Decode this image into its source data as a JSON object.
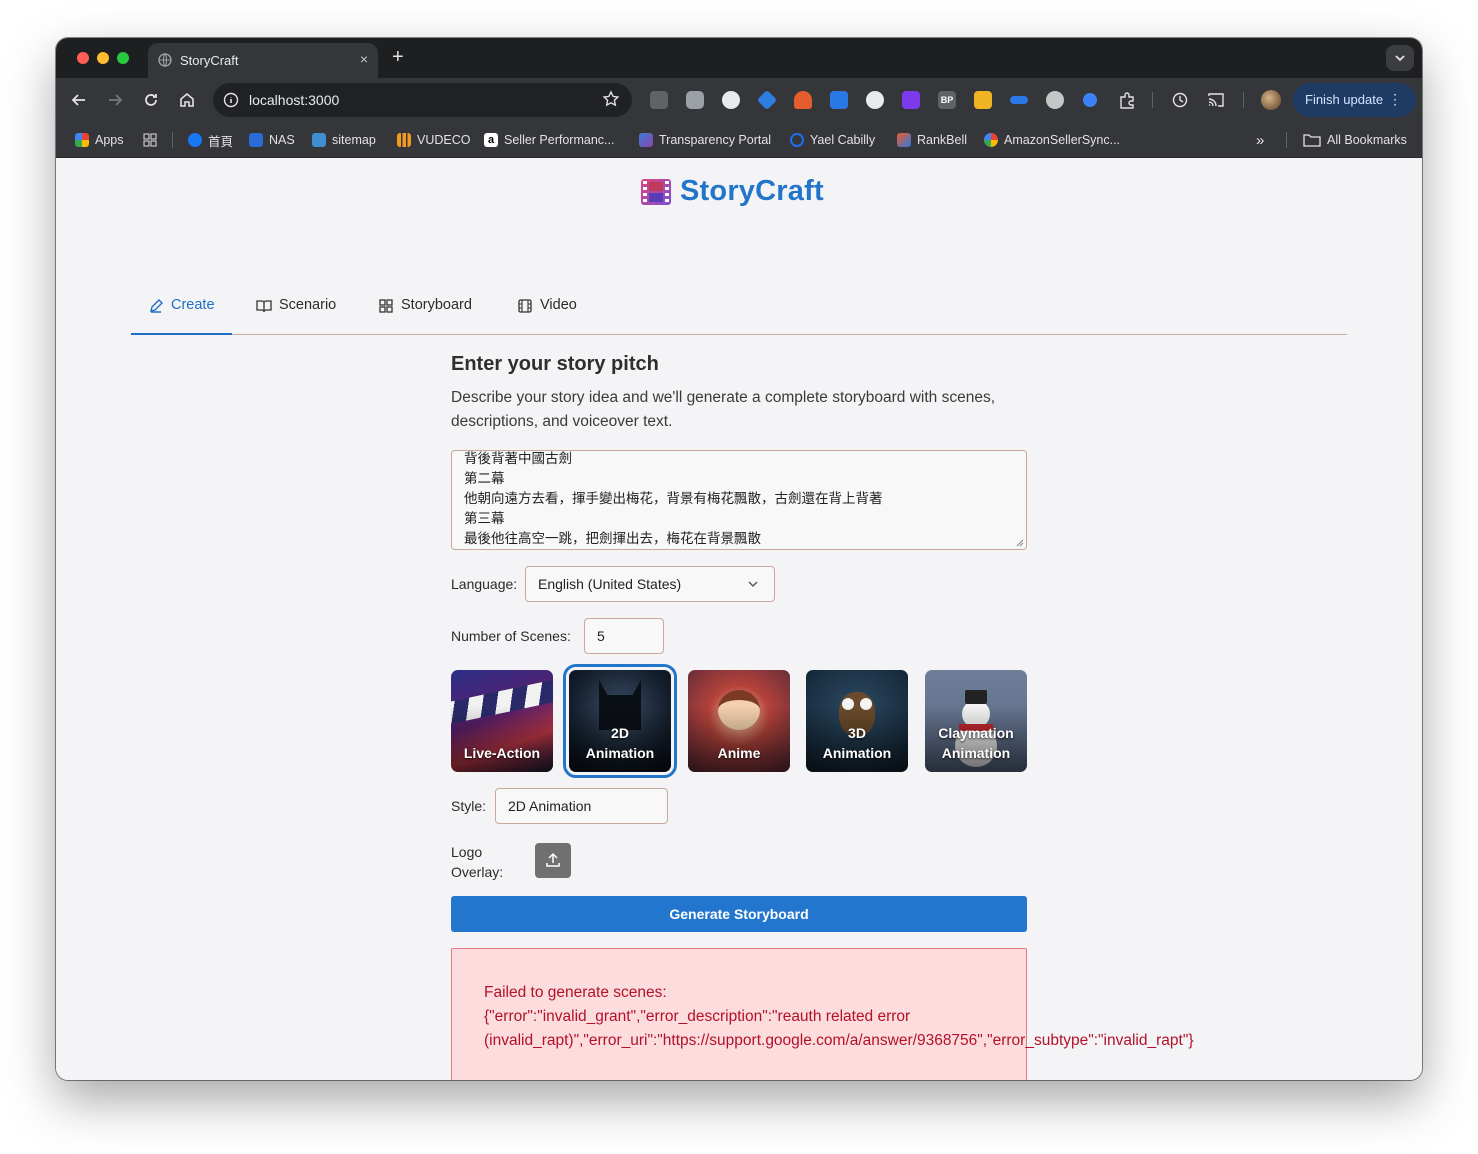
{
  "browser": {
    "tab_title": "StoryCraft",
    "tab_close": "×",
    "new_tab": "+",
    "url": "localhost:3000",
    "finish_update": "Finish update",
    "bookmarks": [
      {
        "label": "Apps",
        "icon": "apps-grid-icon",
        "color": "#e8453c"
      },
      {
        "label": "",
        "icon": "grid-icon",
        "color": "#e3e3e3"
      },
      {
        "label": "首頁",
        "icon": "facebook-icon",
        "color": "#1877f2"
      },
      {
        "label": "NAS",
        "icon": "dsm-icon",
        "color": "#2a6bd6"
      },
      {
        "label": "sitemap",
        "icon": "sitemap-icon",
        "color": "#3e8ed0"
      },
      {
        "label": "VUDECO",
        "icon": "analytics-icon",
        "color": "#f29a1d"
      },
      {
        "label": "Seller Performanc...",
        "icon": "amazon-icon",
        "color": "#ffffff"
      },
      {
        "label": "Transparency Portal",
        "icon": "transparency-icon",
        "color": "#3a7bd5"
      },
      {
        "label": "Yael Cabilly",
        "icon": "ring-icon",
        "color": "#1d6ef0"
      },
      {
        "label": "RankBell",
        "icon": "rankbell-icon",
        "color": "#f05a28"
      },
      {
        "label": "AmazonSellerSync...",
        "icon": "google-icon",
        "color": "#ffffff"
      }
    ],
    "overflow": "»",
    "all_bookmarks": "All Bookmarks"
  },
  "app": {
    "brand": "StoryCraft",
    "tabs": [
      {
        "label": "Create",
        "icon": "pencil-icon",
        "active": true
      },
      {
        "label": "Scenario",
        "icon": "book-icon",
        "active": false
      },
      {
        "label": "Storyboard",
        "icon": "grid-icon",
        "active": false
      },
      {
        "label": "Video",
        "icon": "film-icon",
        "active": false
      }
    ],
    "heading": "Enter your story pitch",
    "description": "Describe your story idea and we'll generate a complete storyboard with scenes, descriptions, and voiceover text.",
    "pitch_lines": [
      "背後背著中國古劍",
      "第二幕",
      "他朝向遠方去看，揮手變出梅花，背景有梅花飄散，古劍還在背上背著",
      "第三幕",
      "最後他往高空一跳，把劍揮出去，梅花在背景飄散"
    ],
    "language_label": "Language:",
    "language_value": "English (United States)",
    "scenes_label": "Number of Scenes:",
    "scenes_value": "5",
    "styles": [
      {
        "line1": "",
        "line2": "Live-Action",
        "selected": false
      },
      {
        "line1": "2D",
        "line2": "Animation",
        "selected": true
      },
      {
        "line1": "",
        "line2": "Anime",
        "selected": false
      },
      {
        "line1": "3D",
        "line2": "Animation",
        "selected": false
      },
      {
        "line1": "Claymation",
        "line2": "Animation",
        "selected": false
      }
    ],
    "style_label": "Style:",
    "style_value": "2D Animation",
    "logo_label_1": "Logo",
    "logo_label_2": "Overlay:",
    "generate_label": "Generate Storyboard",
    "error_lines": [
      "Failed to generate scenes:",
      "{\"error\":\"invalid_grant\",\"error_description\":\"reauth related error",
      "(invalid_rapt)\",\"error_uri\":\"https://support.google.com/a/answer/9368756\",\"error_subtype\":\"invalid_rapt\"}"
    ]
  },
  "colors": {
    "accent": "#2275c9",
    "error_text": "#b3112a",
    "error_bg": "#fcdcdd"
  }
}
